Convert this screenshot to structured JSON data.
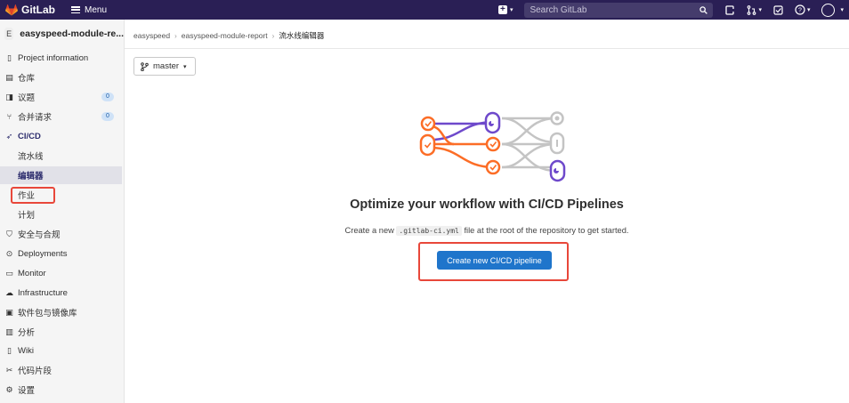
{
  "topbar": {
    "brand": "GitLab",
    "menu_label": "Menu",
    "search_placeholder": "Search GitLab"
  },
  "sidebar": {
    "project_initial": "E",
    "project_name": "easyspeed-module-re...",
    "items": [
      {
        "label": "Project information",
        "icon": "project-info-icon"
      },
      {
        "label": "仓库",
        "icon": "repository-icon"
      },
      {
        "label": "议题",
        "icon": "issues-icon",
        "count": "0"
      },
      {
        "label": "合并请求",
        "icon": "merge-request-icon",
        "count": "0"
      },
      {
        "label": "CI/CD",
        "icon": "rocket-icon"
      },
      {
        "label": "流水线"
      },
      {
        "label": "编辑器"
      },
      {
        "label": "作业"
      },
      {
        "label": "计划"
      },
      {
        "label": "安全与合规",
        "icon": "shield-icon"
      },
      {
        "label": "Deployments",
        "icon": "deployments-icon"
      },
      {
        "label": "Monitor",
        "icon": "monitor-icon"
      },
      {
        "label": "Infrastructure",
        "icon": "infrastructure-icon"
      },
      {
        "label": "软件包与镜像库",
        "icon": "package-icon"
      },
      {
        "label": "分析",
        "icon": "chart-icon"
      },
      {
        "label": "Wiki",
        "icon": "book-icon"
      },
      {
        "label": "代码片段",
        "icon": "snippet-icon"
      },
      {
        "label": "设置",
        "icon": "gear-icon"
      }
    ]
  },
  "breadcrumb": [
    "easyspeed",
    "easyspeed-module-report",
    "流水线编辑器"
  ],
  "branch": "master",
  "empty_state": {
    "title": "Optimize your workflow with CI/CD Pipelines",
    "desc_before": "Create a new",
    "desc_code": ".gitlab-ci.yml",
    "desc_after": "file at the root of the repository to get started.",
    "button": "Create new CI/CD pipeline"
  },
  "colors": {
    "topbar": "#2a1f55",
    "primary_button": "#1f75cb",
    "highlight": "#e8473a",
    "illus_orange": "#fc6d26",
    "illus_purple": "#6e49cb",
    "illus_gray": "#bfbfbf"
  }
}
